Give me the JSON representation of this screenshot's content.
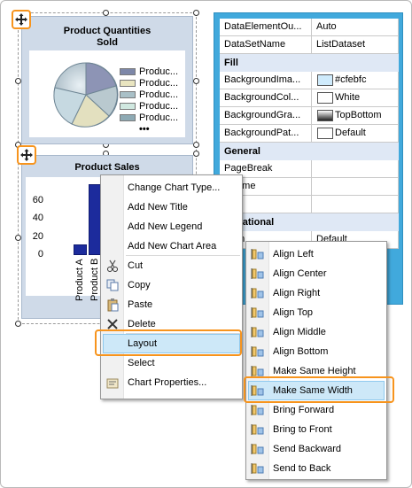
{
  "chart1": {
    "title_line1": "Product Quantities",
    "title_line2": "Sold",
    "legend": [
      "Produc...",
      "Produc...",
      "Produc...",
      "Produc...",
      "Produc..."
    ],
    "legend_colors": [
      "#7d87a8",
      "#e9e5c0",
      "#a9c0c7",
      "#d0e8e0",
      "#8eaab4"
    ],
    "legend_more": "•••"
  },
  "chart_data": {
    "type": "bar",
    "title": "Product Sales",
    "categories": [
      "Product A",
      "Product B"
    ],
    "values": [
      12,
      78
    ],
    "yticks": [
      "0",
      "20",
      "40",
      "60"
    ],
    "ylim": [
      0,
      80
    ]
  },
  "properties": {
    "rows": [
      {
        "kind": "row",
        "name": "DataElementOu...",
        "value": "Auto"
      },
      {
        "kind": "row",
        "name": "DataSetName",
        "value": "ListDataset"
      },
      {
        "kind": "cat",
        "name": "Fill"
      },
      {
        "kind": "row",
        "name": "BackgroundIma...",
        "value": "#cfebfc",
        "swatch": "#cfebfc"
      },
      {
        "kind": "row",
        "name": "BackgroundCol...",
        "value": "White",
        "swatch": "#ffffff"
      },
      {
        "kind": "row",
        "name": "BackgroundGra...",
        "value": "TopBottom",
        "swatch": "gradient"
      },
      {
        "kind": "row",
        "name": "BackgroundPat...",
        "value": "Default",
        "swatch": "#ffffff"
      },
      {
        "kind": "cat",
        "name": "General"
      },
      {
        "kind": "row",
        "name": "PageBreak",
        "value": ""
      },
      {
        "kind": "row",
        "name": "eName",
        "value": ""
      },
      {
        "kind": "row",
        "name": "Tip",
        "value": ""
      },
      {
        "kind": "cat",
        "name": "ternational"
      },
      {
        "kind": "row",
        "name": "ction",
        "value": "Default"
      }
    ]
  },
  "context_menu": {
    "items": [
      {
        "label": "Change Chart Type...",
        "icon": ""
      },
      {
        "label": "Add New Title",
        "icon": ""
      },
      {
        "label": "Add New Legend",
        "icon": ""
      },
      {
        "label": "Add New Chart Area",
        "icon": ""
      },
      {
        "label": "Cut",
        "icon": "scissors-icon"
      },
      {
        "label": "Copy",
        "icon": "copy-icon"
      },
      {
        "label": "Paste",
        "icon": "paste-icon"
      },
      {
        "label": "Delete",
        "icon": "delete-icon"
      },
      {
        "label": "Layout",
        "icon": "",
        "highlighted": true
      },
      {
        "label": "Select",
        "icon": ""
      },
      {
        "label": "Chart Properties...",
        "icon": "properties-icon"
      }
    ]
  },
  "layout_menu": {
    "items": [
      {
        "label": "Align Left",
        "icon": "align-left-icon"
      },
      {
        "label": "Align Center",
        "icon": "align-center-icon"
      },
      {
        "label": "Align Right",
        "icon": "align-right-icon"
      },
      {
        "label": "Align Top",
        "icon": "align-top-icon"
      },
      {
        "label": "Align Middle",
        "icon": "align-middle-icon"
      },
      {
        "label": "Align Bottom",
        "icon": "align-bottom-icon"
      },
      {
        "label": "Make Same Height",
        "icon": "same-height-icon"
      },
      {
        "label": "Make Same Width",
        "icon": "same-width-icon",
        "highlighted": true
      },
      {
        "label": "Bring Forward",
        "icon": "bring-forward-icon"
      },
      {
        "label": "Bring to Front",
        "icon": "bring-to-front-icon"
      },
      {
        "label": "Send Backward",
        "icon": "send-backward-icon"
      },
      {
        "label": "Send to Back",
        "icon": "send-to-back-icon"
      }
    ]
  },
  "colors": {
    "accent_orange": "#f7941d",
    "property_grid_bg": "#41a9dc",
    "bar_color": "#1c2b9c",
    "chart_bg": "#cfdae8",
    "menu_highlight": "#cde8f8"
  }
}
